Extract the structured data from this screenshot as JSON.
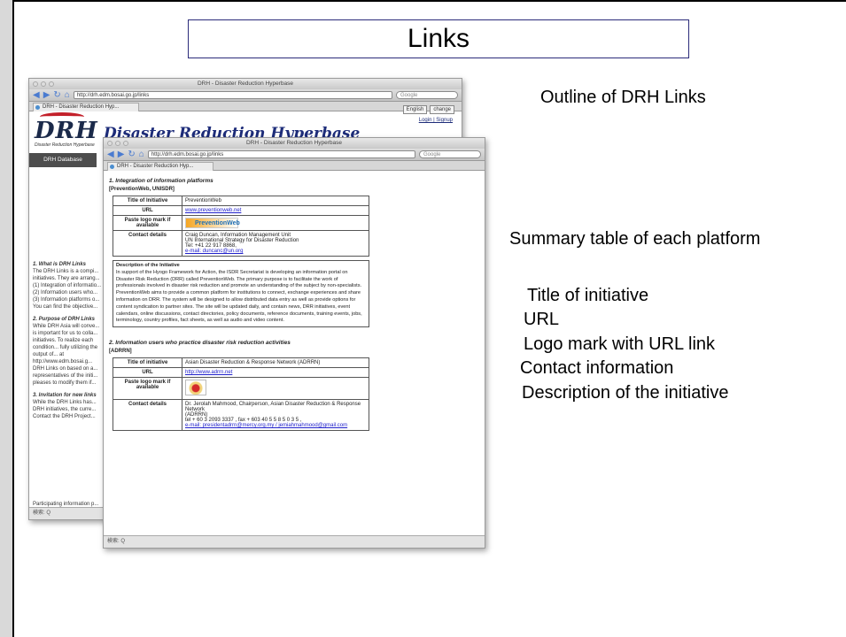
{
  "slide": {
    "title": "Links",
    "right_text": {
      "outline": "Outline of DRH Links",
      "summary": "Summary table of each platform",
      "items": [
        "Title of initiative",
        "URL",
        "Logo mark with URL link",
        "Contact information",
        "Description of the initiative"
      ]
    }
  },
  "browser_back": {
    "window_title": "DRH - Disaster Reduction Hyperbase",
    "url": "http://drh.edm.bosai.go.jp/links",
    "search_placeholder": "Google",
    "tab_label": "DRH - Disaster Reduction Hyp...",
    "language": "English",
    "change_button": "change",
    "login_text": "Login | Signup",
    "logo_text": "DRH",
    "logo_sub": "Disaster Reduction Hyperbase",
    "heading": "Disaster Reduction Hyperbase",
    "sidebar_button": "DRH Database",
    "left_sections": [
      {
        "heading": "1. What is DRH Links",
        "text": "The DRH Links is a compi... initiatives. They are arrang... (1) Integration of informatio... (2) Information users who... (3) Information platforms o... You can find the objective..."
      },
      {
        "heading": "2. Purpose of DRH Links",
        "text": "While DRH Asia will conve... is important for us to colla... initiatives. To realize each condition... fully utilizing the output of... at http://www.edm.bosai.g... DRH Links on based on a... representatives of the initi... pleases to modify them if..."
      },
      {
        "heading": "3. Invitation for new links",
        "text": "While the DRH Links has... DRH initiatives, the curre... Contact the DRH Project..."
      }
    ],
    "left_footer": "Participating information p...",
    "status_text": "検索: Q"
  },
  "browser_front": {
    "window_title": "DRH - Disaster Reduction Hyperbase",
    "url": "http://drh.edm.bosai.go.jp/links",
    "search_placeholder": "Google",
    "tab_label": "DRH - Disaster Reduction Hyp...",
    "section1_heading": "1. Integration of information platforms",
    "section1_org": "[PreventionWeb, UNISDR]",
    "table1": {
      "title_label": "Title of Initiative",
      "title_value": "PreventionWeb",
      "url_label": "URL",
      "url_value": "www.preventionweb.net",
      "logo_label": "Paste logo mark if available",
      "logo_text": "PreventionWeb",
      "contact_label": "Contact details",
      "contact_lines": [
        "Craig Duncan, Information Management Unit",
        "UN International Strategy for Disaster Reduction",
        "Tel: +41 22 917 8868,",
        "e-mail: duncanc@un.org"
      ]
    },
    "desc_title": "Description of the Initiative",
    "desc_text": "In support of the Hyogo Framework for Action, the ISDR Secretariat is developing an information portal on Disaster Risk Reduction (DRR) called PreventionWeb. The primary purpose is to facilitate the work of professionals involved in disaster risk reduction and promote an understanding of the subject by non-specialists. PreventionWeb aims to provide a common platform for institutions to connect, exchange experiences and share information on DRR. The system will be designed to allow distributed data entry as well as provide options for content syndication to partner sites. The site will be updated daily, and contain news, DRR initiatives, event calendars, online discussions, contact directories, policy documents, reference documents, training events, jobs, terminology, country profiles, fact sheets, as well as audio and video content.",
    "section2_heading": "2. Information users who practice disaster risk reduction activities",
    "section2_org": "[ADRRN]",
    "table2": {
      "title_label": "Title of initiative",
      "title_value": "Asian Disaster Reduction & Response Network (ADRRN)",
      "url_label": "URL",
      "url_value": "http://www.adrrn.net",
      "logo_label": "Paste logo mark if available",
      "contact_label": "Contact details",
      "contact_lines": [
        "Dr. Jerolah Mahmood, Chairperson, Asian Disaster Reduction & Response Network",
        "(ADRRN)",
        "tel + 60 3 2093 3337 , fax + 603 40 5 5 8 5 0 3 5 ,",
        "e-mail: presidentadrrn@mercy.org.my / jemiahmahmood@gmail.com"
      ]
    },
    "status_text": "検索: Q"
  },
  "colors": {
    "title_border": "#2b2b7a",
    "drh_heading": "#1d2c79",
    "logo_red": "#c3202a",
    "link_blue": "#2222cc"
  }
}
